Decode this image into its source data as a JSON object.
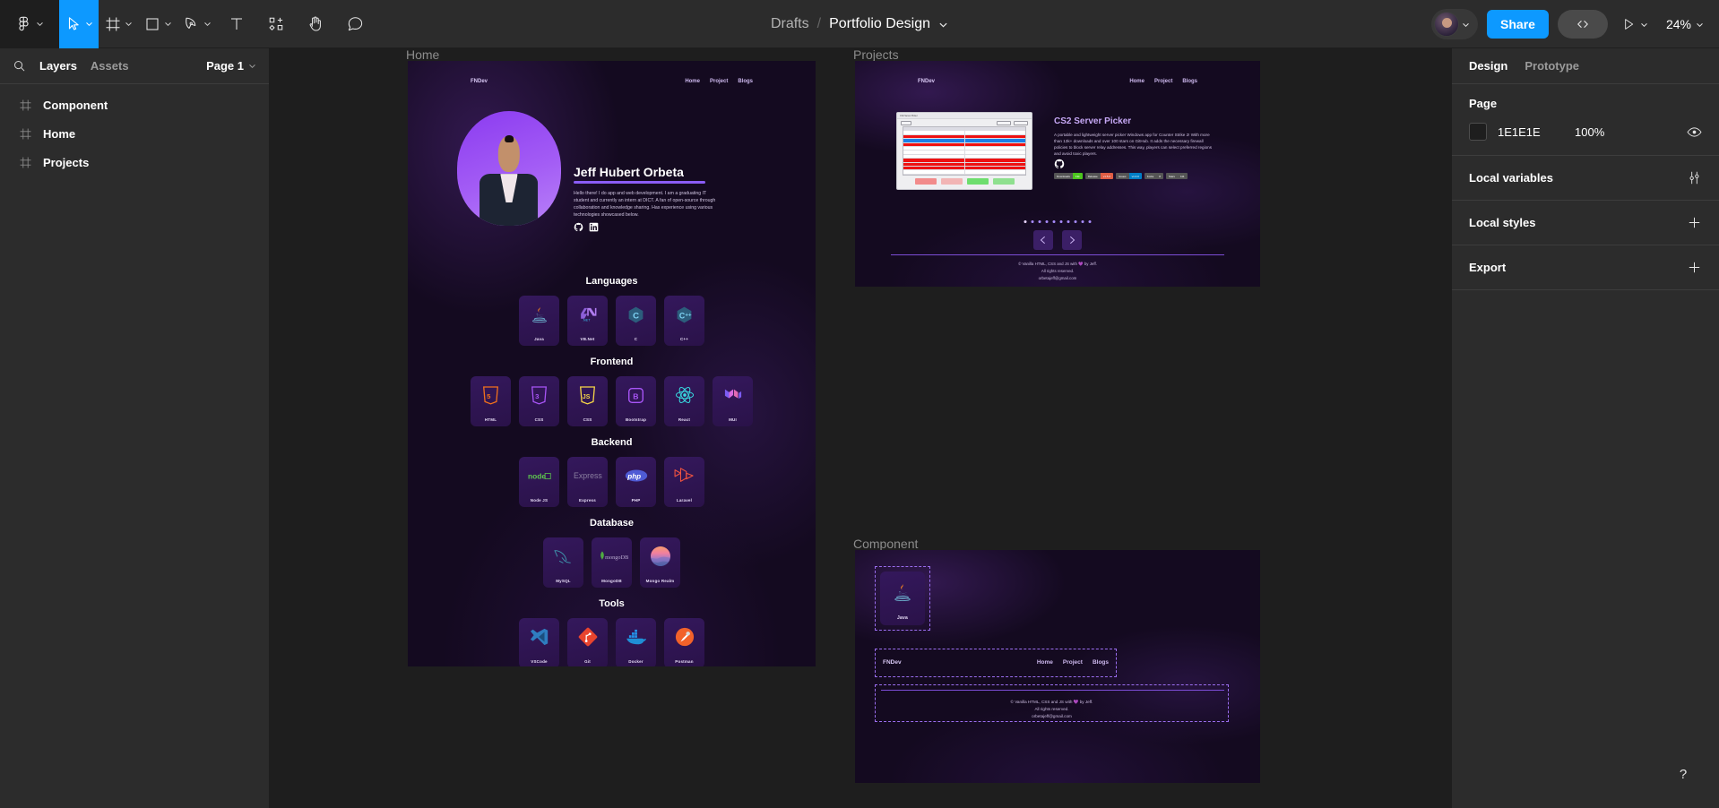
{
  "toolbar": {
    "tools": [
      {
        "name": "figma-menu",
        "icon": "figma-logo-icon",
        "has_caret": true
      },
      {
        "name": "move-tool",
        "icon": "cursor-arrow-icon",
        "has_caret": true,
        "active": true
      },
      {
        "name": "frame-tool",
        "icon": "frame-icon",
        "has_caret": true
      },
      {
        "name": "shape-tool",
        "icon": "rectangle-icon",
        "has_caret": true
      },
      {
        "name": "pen-tool",
        "icon": "pen-icon",
        "has_caret": true
      },
      {
        "name": "text-tool",
        "icon": "text-icon",
        "has_caret": false
      },
      {
        "name": "actions-tool",
        "icon": "resources-plus-icon",
        "has_caret": false
      },
      {
        "name": "hand-tool",
        "icon": "hand-icon",
        "has_caret": false
      },
      {
        "name": "comment-tool",
        "icon": "comment-icon",
        "has_caret": false
      }
    ],
    "breadcrumb_parent": "Drafts",
    "breadcrumb_sep": "/",
    "breadcrumb_title": "Portfolio Design",
    "share_label": "Share",
    "zoom_level": "24%",
    "accent_color": "#0d99ff"
  },
  "left_panel": {
    "tabs": [
      {
        "label": "Layers",
        "active": true
      },
      {
        "label": "Assets",
        "active": false
      }
    ],
    "page_selector": "Page 1",
    "layers": [
      {
        "label": "Component",
        "icon": "frame-icon"
      },
      {
        "label": "Home",
        "icon": "frame-icon"
      },
      {
        "label": "Projects",
        "icon": "frame-icon"
      }
    ]
  },
  "right_panel": {
    "tabs": [
      {
        "label": "Design",
        "active": true
      },
      {
        "label": "Prototype",
        "active": false
      }
    ],
    "page_section": {
      "title": "Page",
      "fill_hex": "1E1E1E",
      "fill_color": "#1e1e1e",
      "opacity": "100%",
      "visibility_icon": "eye-icon"
    },
    "rows": [
      {
        "label": "Local variables",
        "action_icon": "sliders-icon"
      },
      {
        "label": "Local styles",
        "action_icon": "plus-icon"
      },
      {
        "label": "Export",
        "action_icon": "plus-icon"
      }
    ]
  },
  "help_button": {
    "label": "?",
    "name": "help-button"
  },
  "canvas": {
    "frames": [
      {
        "label": "Home"
      },
      {
        "label": "Projects"
      },
      {
        "label": "Component"
      }
    ],
    "site": {
      "brand": "FNDev",
      "nav_links": [
        "Home",
        "Project",
        "Blogs"
      ],
      "hero": {
        "name": "Jeff Hubert Orbeta",
        "description": "Hello there! I do app and web development. I am a graduating IT student and currently an intern at DICT. A fan of open-source through collaboration and knowledge sharing. Has experience using various technologies showcased below.",
        "socials": [
          "github-icon",
          "linkedin-icon"
        ]
      },
      "sections": [
        {
          "title": "Languages",
          "cards": [
            {
              "label": "Java",
              "icon": "java-icon"
            },
            {
              "label": "VB.Net",
              "icon": "dotnet-icon"
            },
            {
              "label": "C",
              "icon": "c-icon"
            },
            {
              "label": "C++",
              "icon": "cpp-icon"
            }
          ]
        },
        {
          "title": "Frontend",
          "cards": [
            {
              "label": "HTML",
              "icon": "html5-icon"
            },
            {
              "label": "CSS",
              "icon": "css3-icon"
            },
            {
              "label": "CSS",
              "icon": "javascript-icon"
            },
            {
              "label": "Bootstrap",
              "icon": "bootstrap-icon"
            },
            {
              "label": "React",
              "icon": "react-icon"
            },
            {
              "label": "MUI",
              "icon": "mui-icon"
            }
          ]
        },
        {
          "title": "Backend",
          "cards": [
            {
              "label": "Node JS",
              "icon": "nodejs-icon"
            },
            {
              "label": "Express",
              "icon": "express-icon"
            },
            {
              "label": "PHP",
              "icon": "php-icon"
            },
            {
              "label": "Laravel",
              "icon": "laravel-icon"
            }
          ]
        },
        {
          "title": "Database",
          "cards": [
            {
              "label": "MySQL",
              "icon": "mysql-icon"
            },
            {
              "label": "MongoDB",
              "icon": "mongodb-icon"
            },
            {
              "label": "Mongo Realm",
              "icon": "mongo-realm-icon"
            }
          ]
        },
        {
          "title": "Tools",
          "cards": [
            {
              "label": "VSCode",
              "icon": "vscode-icon"
            },
            {
              "label": "Git",
              "icon": "git-icon"
            },
            {
              "label": "Docker",
              "icon": "docker-icon"
            },
            {
              "label": "Postman",
              "icon": "postman-icon"
            }
          ]
        }
      ],
      "footer": {
        "line1": "© Vanilla HTML, CSS and JS with 💜 by Jeff.",
        "line2": "All rights reserved.",
        "line3": "orbetajeff@gmail.com"
      },
      "project": {
        "title": "CS2 Server Picker",
        "description": "A portable and lightweight server picker Windows app for Counter Strike 2! With more than 13k+ downloads and over 100 stars on GitHub. It adds the necessary firewall policies to block server relay addresses. This way, players can select preferred regions and avoid toxic players.",
        "repo_icon": "github-icon",
        "badges": [
          {
            "key": "Downloads",
            "value": "13k",
            "color": "#4bc51d"
          },
          {
            "key": "Release",
            "value": "v1.5.0",
            "color": "#e05d44"
          },
          {
            "key": "Issues",
            "value": "v1.0.0",
            "color": "#007ec6"
          },
          {
            "key": "Forks",
            "value": "8",
            "color": "#555555"
          },
          {
            "key": "Stars",
            "value": "111",
            "color": "#555555"
          }
        ],
        "carousel_dots": 10,
        "prev_label": "‹",
        "next_label": "›"
      }
    }
  }
}
